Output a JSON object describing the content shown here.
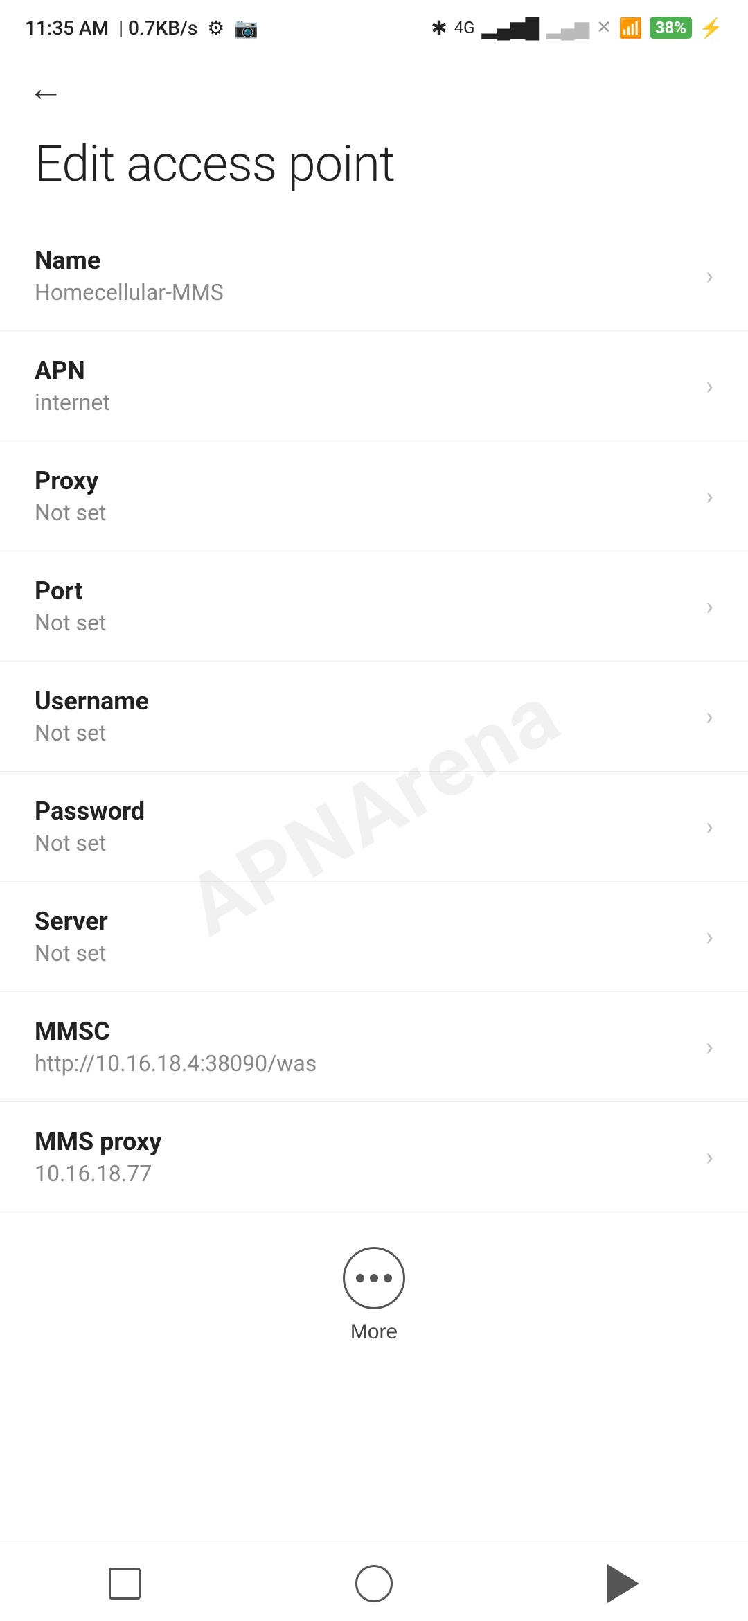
{
  "statusBar": {
    "time": "11:35 AM",
    "speed": "0.7KB/s",
    "bluetooth": "⚡",
    "battery": "38"
  },
  "header": {
    "backLabel": "←",
    "title": "Edit access point"
  },
  "settings": [
    {
      "label": "Name",
      "value": "Homecellular-MMS"
    },
    {
      "label": "APN",
      "value": "internet"
    },
    {
      "label": "Proxy",
      "value": "Not set"
    },
    {
      "label": "Port",
      "value": "Not set"
    },
    {
      "label": "Username",
      "value": "Not set"
    },
    {
      "label": "Password",
      "value": "Not set"
    },
    {
      "label": "Server",
      "value": "Not set"
    },
    {
      "label": "MMSC",
      "value": "http://10.16.18.4:38090/was"
    },
    {
      "label": "MMS proxy",
      "value": "10.16.18.77"
    }
  ],
  "moreButton": {
    "label": "More"
  },
  "watermark": "APNArena",
  "bottomNav": {
    "squareLabel": "recent-apps",
    "circleLabel": "home",
    "triangleLabel": "back"
  }
}
